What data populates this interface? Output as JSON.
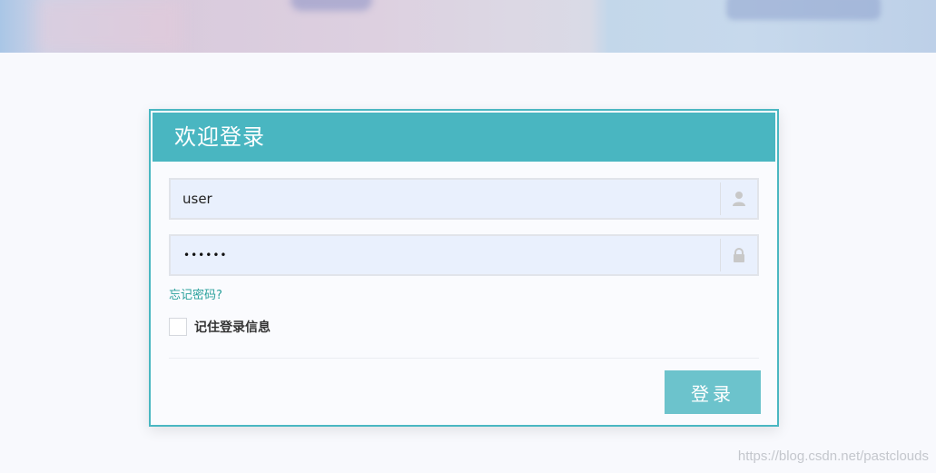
{
  "login": {
    "title": "欢迎登录",
    "username_value": "user",
    "password_masked": "••••••",
    "forgot_label": "忘记密码?",
    "remember_label": "记住登录信息",
    "remember_checked": false,
    "submit_label": "登录"
  },
  "icons": {
    "username": "user-icon",
    "password": "lock-icon"
  },
  "watermark": "https://blog.csdn.net/pastclouds",
  "colors": {
    "accent": "#49b6c1",
    "button": "#6cc3cc",
    "link": "#2aa19c",
    "input_bg": "#e9f0fd"
  }
}
